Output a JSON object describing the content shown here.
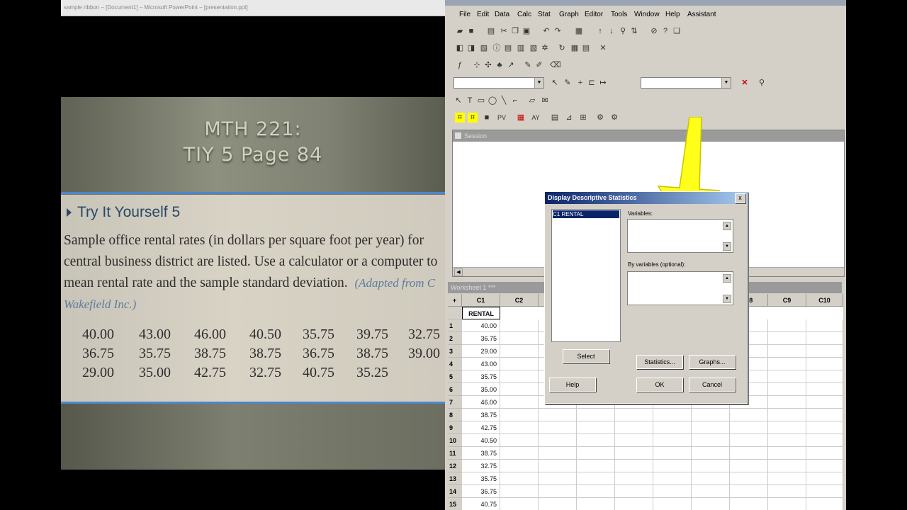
{
  "browser": {
    "address_text": "sample ribbon – [Document1] – Microsoft PowerPoint – [presentation.ppt]"
  },
  "slide": {
    "title_line1": "MTH 221:",
    "title_line2": "TIY 5 Page 84",
    "heading": "Try It Yourself 5",
    "body_lines": [
      "Sample office rental rates (in dollars per square foot per year) for",
      "central business district are listed. Use a calculator or a computer to",
      "mean rental rate and the sample standard deviation."
    ],
    "citation_part1": "(Adapted from C",
    "citation_part2": "Wakefield Inc.)",
    "data_rows": [
      [
        "40.00",
        "43.00",
        "46.00",
        "40.50",
        "35.75",
        "39.75",
        "32.75"
      ],
      [
        "36.75",
        "35.75",
        "38.75",
        "38.75",
        "36.75",
        "38.75",
        "39.00"
      ],
      [
        "29.00",
        "35.00",
        "42.75",
        "32.75",
        "40.75",
        "35.25"
      ]
    ]
  },
  "minitab": {
    "menu": [
      "File",
      "Edit",
      "Data",
      "Calc",
      "Stat",
      "Graph",
      "Editor",
      "Tools",
      "Window",
      "Help",
      "Assistant"
    ],
    "session_title": "Session",
    "worksheet_title": "Worksheet 1 ***",
    "columns": [
      "C1",
      "C2",
      "C8",
      "C9",
      "C10"
    ],
    "column_name_c1": "RENTAL",
    "row_header_corner": "+",
    "rows": [
      "1",
      "2",
      "3",
      "4",
      "5",
      "6",
      "7",
      "8",
      "9",
      "10",
      "11",
      "12",
      "13",
      "14",
      "15"
    ],
    "c1_values": [
      "40.00",
      "36.75",
      "29.00",
      "43.00",
      "35.75",
      "35.00",
      "46.00",
      "38.75",
      "42.75",
      "40.50",
      "38.75",
      "32.75",
      "35.75",
      "36.75",
      "40.75"
    ]
  },
  "dialog": {
    "title": "Display Descriptive Statistics",
    "close_label": "x",
    "list_item": "C1     RENTAL",
    "variables_label": "Variables:",
    "by_variables_label": "By variables (optional):",
    "select_label": "Select",
    "statistics_label": "Statistics...",
    "graphs_label": "Graphs...",
    "help_label": "Help",
    "ok_label": "OK",
    "cancel_label": "Cancel"
  },
  "colors": {
    "dialog_title_start": "#0a246a",
    "dialog_title_end": "#a6caf0",
    "arrow_fill": "#ffff1a",
    "slide_rule": "#4d86c9"
  }
}
